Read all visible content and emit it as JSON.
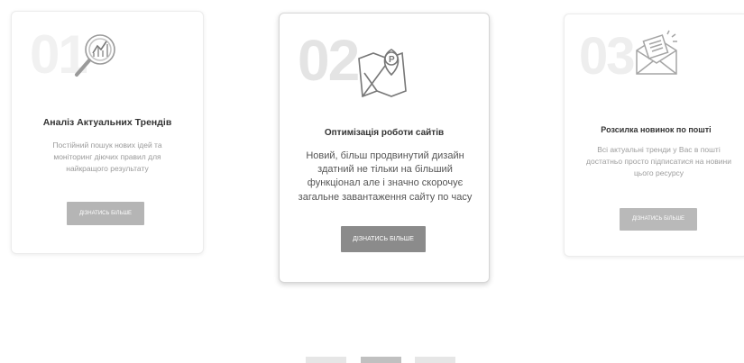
{
  "cards": [
    {
      "number": "01",
      "icon": "magnifier-chart-icon",
      "title": "Аналіз Актуальних Трендів",
      "description": "Постійний пошук нових ідей та моніторинг діючих правил для найкращого результату",
      "button": "Дізнатись більше"
    },
    {
      "number": "02",
      "icon": "map-parking-pin-icon",
      "title": "Оптимізація роботи сайтів",
      "description": "Новий, більш продвинутий дизайн здатний не тільки на більший функціонал але і значно скорочує загальне завантаження сайту по часу",
      "button": "Дізнатись більше"
    },
    {
      "number": "03",
      "icon": "envelope-newsletter-icon",
      "title": "Розсилка новинок по пошті",
      "description": "Всі актуальні тренди у Вас в пошті достатньо просто підписатися на новини цього ресурсу",
      "button": "Дізнатись більше"
    }
  ],
  "pagination": {
    "count": 3,
    "active_index": 1
  },
  "colors": {
    "active_dot": "#c0c0c0",
    "inactive_dot": "#e6e6e6",
    "button_active": "#8b8b8b"
  }
}
